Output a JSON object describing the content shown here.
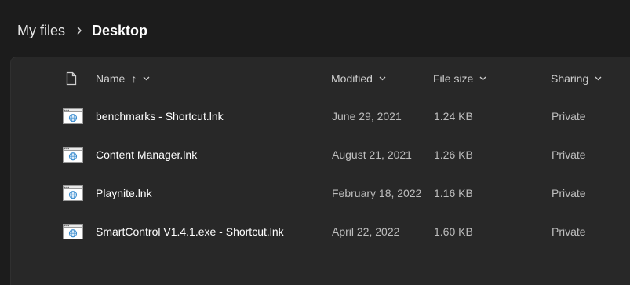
{
  "breadcrumb": {
    "root": "My files",
    "current": "Desktop"
  },
  "columns": {
    "name": "Name",
    "sort_arrow": "↑",
    "modified": "Modified",
    "file_size": "File size",
    "sharing": "Sharing"
  },
  "files": [
    {
      "name": "benchmarks - Shortcut.lnk",
      "modified": "June 29, 2021",
      "size": "1.24 KB",
      "sharing": "Private",
      "icon": "shortcut-file-icon"
    },
    {
      "name": "Content Manager.lnk",
      "modified": "August 21, 2021",
      "size": "1.26 KB",
      "sharing": "Private",
      "icon": "shortcut-file-icon"
    },
    {
      "name": "Playnite.lnk",
      "modified": "February 18, 2022",
      "size": "1.16 KB",
      "sharing": "Private",
      "icon": "shortcut-file-icon"
    },
    {
      "name": "SmartControl V1.4.1.exe - Shortcut.lnk",
      "modified": "April 22, 2022",
      "size": "1.60 KB",
      "sharing": "Private",
      "icon": "shortcut-file-icon"
    }
  ],
  "colors": {
    "background": "#1c1c1c",
    "panel": "#282828",
    "text_primary": "#ffffff",
    "text_secondary": "#bdbdbd",
    "icon_accent": "#3f8fd0"
  }
}
